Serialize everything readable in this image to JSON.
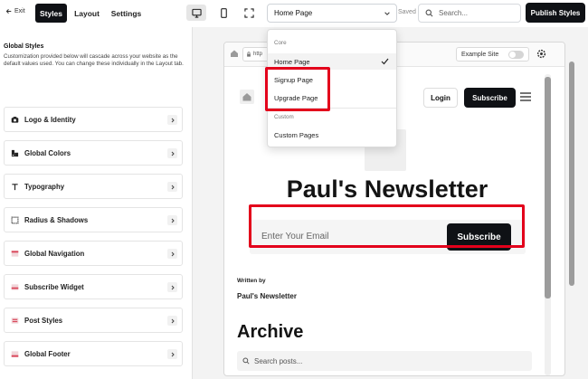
{
  "topbar": {
    "exit_label": "Exit",
    "tabs": [
      {
        "label": "Styles",
        "active": true
      },
      {
        "label": "Layout",
        "active": false
      },
      {
        "label": "Settings",
        "active": false
      }
    ],
    "devices": [
      "desktop-icon",
      "mobile-icon",
      "fullscreen-icon"
    ],
    "page_select_value": "Home Page",
    "saved_text": "Saved",
    "search_placeholder": "Search...",
    "publish_label": "Publish Styles"
  },
  "sidebar": {
    "title": "Global Styles",
    "description": "Customization provided below will cascade across your website as the default values used. You can change these individually in the Layout tab.",
    "items": [
      {
        "label": "Logo & Identity",
        "icon": "camera-icon"
      },
      {
        "label": "Global Colors",
        "icon": "palette-icon"
      },
      {
        "label": "Typography",
        "icon": "text-icon"
      },
      {
        "label": "Radius & Shadows",
        "icon": "square-icon"
      },
      {
        "label": "Global Navigation",
        "icon": "navigation-icon"
      },
      {
        "label": "Subscribe Widget",
        "icon": "widget-icon"
      },
      {
        "label": "Post Styles",
        "icon": "post-icon"
      },
      {
        "label": "Global Footer",
        "icon": "footer-icon"
      }
    ]
  },
  "dropdown": {
    "groups": [
      {
        "label": "Core",
        "items": [
          {
            "label": "Home Page",
            "selected": true
          },
          {
            "label": "Signup Page",
            "selected": false
          },
          {
            "label": "Upgrade Page",
            "selected": false
          }
        ]
      },
      {
        "label": "Custom",
        "items": [
          {
            "label": "Custom Pages",
            "selected": false
          }
        ]
      }
    ]
  },
  "preview": {
    "url_text": "http",
    "example_site_label": "Example Site",
    "login_label": "Login",
    "subscribe_label": "Subscribe",
    "newsletter_title": "Paul's Newsletter",
    "email_placeholder": "Enter Your Email",
    "email_subscribe_label": "Subscribe",
    "written_by_label": "Written by",
    "author_name": "Paul's Newsletter",
    "archive_title": "Archive",
    "search_posts_placeholder": "Search posts..."
  },
  "colors": {
    "accent_dark": "#0f1115",
    "annotation_red": "#e3001b"
  }
}
